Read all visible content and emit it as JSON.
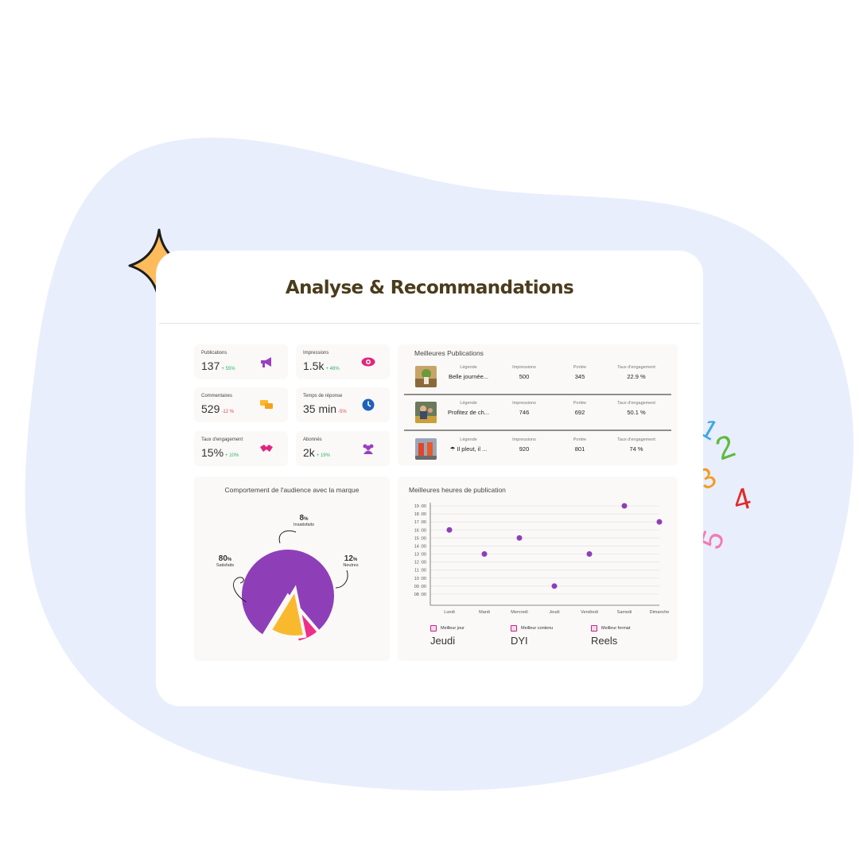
{
  "title": "Analyse & Recommandations",
  "kpis": [
    {
      "label": "Publications",
      "value": "137",
      "delta": "+ 55%",
      "trend": "up",
      "icon": "megaphone-icon"
    },
    {
      "label": "Impressions",
      "value": "1.5k",
      "delta": "+ 46%",
      "trend": "up",
      "icon": "eye-icon"
    },
    {
      "label": "Commentaires",
      "value": "529",
      "delta": "-12 %",
      "trend": "down",
      "icon": "chat-bubbles-icon"
    },
    {
      "label": "Temps de réponse",
      "value": "35 min",
      "delta": "-5%",
      "trend": "down",
      "icon": "clock-icon"
    },
    {
      "label": "Taux d'engagement",
      "value": "15%",
      "delta": "+ 10%",
      "trend": "up",
      "icon": "handshake-icon"
    },
    {
      "label": "Abonnés",
      "value": "2k",
      "delta": "+ 19%",
      "trend": "up",
      "icon": "users-icon"
    }
  ],
  "best_publications": {
    "title": "Meilleures Publications",
    "headers": {
      "legend": "Légende",
      "impressions": "Impressions",
      "reach": "Portée",
      "engagement": "Taux d'engagement"
    },
    "rows": [
      {
        "legend": "Belle journée...",
        "impressions": "500",
        "reach": "345",
        "engagement": "22.9 %"
      },
      {
        "legend": "Profitez de ch...",
        "impressions": "746",
        "reach": "692",
        "engagement": "50.1 %"
      },
      {
        "legend": "☂ Il pleut, il ...",
        "impressions": "920",
        "reach": "801",
        "engagement": "74 %"
      }
    ]
  },
  "audience": {
    "title": "Comportement de l'audience avec la marque",
    "slices": [
      {
        "label": "Satisfaits",
        "value": 80,
        "value_text": "80",
        "color": "#8e3fb8"
      },
      {
        "label": "Insatisfaits",
        "value": 8,
        "value_text": "8",
        "color": "#ee2f8a"
      },
      {
        "label": "Neutres",
        "value": 12,
        "value_text": "12",
        "color": "#f9b92f"
      }
    ]
  },
  "best_hours": {
    "title": "Meilleures heures de publication",
    "best": [
      {
        "label": "Meilleur jour",
        "value": "Jeudi"
      },
      {
        "label": "Meilleur contenu",
        "value": "DYI"
      },
      {
        "label": "Meilleur format",
        "value": "Reels"
      }
    ]
  },
  "chart_data": {
    "type": "scatter",
    "title": "Meilleures heures de publication",
    "categories": [
      "Lundi",
      "Mardi",
      "Mercredi",
      "Jeudi",
      "Vendredi",
      "Samedi",
      "Dimanche"
    ],
    "y_ticks": [
      "19 :00",
      "18 :00",
      "17 :00",
      "16 :00",
      "15 :00",
      "14 :00",
      "13 :00",
      "12 :00",
      "11 :00",
      "10 :00",
      "09 :00",
      "08 :00"
    ],
    "values": [
      16,
      13,
      15,
      9,
      13,
      19,
      17
    ],
    "ylim": [
      7,
      19
    ],
    "color": "#8e3fb8",
    "grid": true
  },
  "colors": {
    "blob": "#e8eefc",
    "title": "#4a3c1c",
    "accent": "#8e3fb8"
  },
  "decorations": {
    "digits": [
      "1",
      "2",
      "3",
      "4",
      "5"
    ],
    "digit_colors": [
      "#3ba7e6",
      "#5dbb3c",
      "#f39b1e",
      "#e32828",
      "#f27ab3"
    ]
  }
}
